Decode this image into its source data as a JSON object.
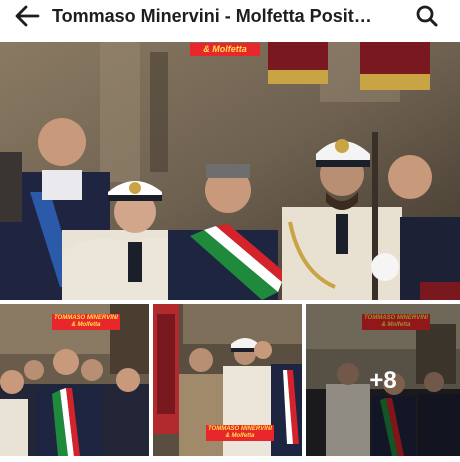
{
  "header": {
    "back_icon": "arrow-left-icon",
    "title": "Tommaso Minervini - Molfetta Posit…",
    "search_icon": "search-icon"
  },
  "post": {
    "main_photo": {
      "description_icon": "photo",
      "banner": "& Molfetta"
    },
    "thumbnails": [
      {
        "banner_line1": "TOMMASO MINERVINI",
        "banner_line2": "& Molfetta"
      },
      {
        "banner_line1": "TOMMASO MINERVINI",
        "banner_line2": "& Molfetta"
      },
      {
        "banner_line1": "TOMMASO MINERVINI",
        "banner_line2": "& Molfetta"
      }
    ],
    "more_count": "+8"
  },
  "colors": {
    "banner_red": "#e8262b",
    "banner_yellow": "#ffe04a",
    "sash_green": "#1f8a3b",
    "sash_red": "#d4232a",
    "naval_white": "#ece6da"
  }
}
